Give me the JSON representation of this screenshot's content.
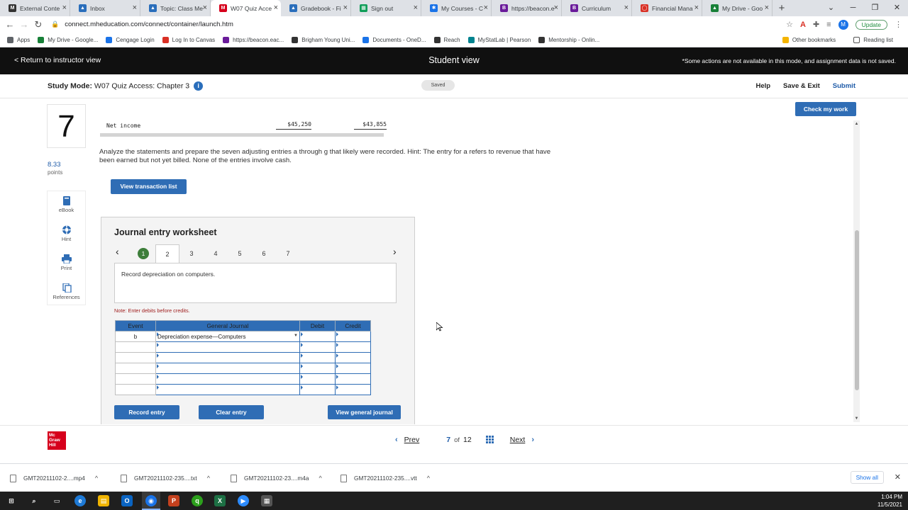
{
  "browser": {
    "tabs": [
      {
        "title": "External Conte",
        "fav_color": "#333333",
        "fav_glyph": "M"
      },
      {
        "title": "Inbox",
        "fav_color": "#2a6ebb",
        "fav_glyph": "▲"
      },
      {
        "title": "Topic: Class Me",
        "fav_color": "#2a6ebb",
        "fav_glyph": "▲"
      },
      {
        "title": "W07 Quiz Acce",
        "fav_color": "#d6001c",
        "fav_glyph": "M"
      },
      {
        "title": "Gradebook - Fi",
        "fav_color": "#2a6ebb",
        "fav_glyph": "▲"
      },
      {
        "title": "Sign out",
        "fav_color": "#0f9d58",
        "fav_glyph": "▦"
      },
      {
        "title": "My Courses - C",
        "fav_color": "#1a73e8",
        "fav_glyph": "✱"
      },
      {
        "title": "https://beacon.e",
        "fav_color": "#6a1b9a",
        "fav_glyph": "B"
      },
      {
        "title": "Curriculum",
        "fav_color": "#6a1b9a",
        "fav_glyph": "B"
      },
      {
        "title": "Financial Mana",
        "fav_color": "#d93025",
        "fav_glyph": "◯"
      },
      {
        "title": "My Drive - Goo",
        "fav_color": "#188038",
        "fav_glyph": "▲"
      }
    ],
    "active_tab_index": 3,
    "url": "connect.mheducation.com/connect/container/launch.htm",
    "profile_initial": "M",
    "update_label": "Update",
    "bookmarks": [
      {
        "label": "Apps",
        "color": "#5f6368"
      },
      {
        "label": "My Drive - Google...",
        "color": "#188038"
      },
      {
        "label": "Cengage Login",
        "color": "#1a73e8"
      },
      {
        "label": "Log In to Canvas",
        "color": "#d93025"
      },
      {
        "label": "https://beacon.eac...",
        "color": "#6a1b9a"
      },
      {
        "label": "Brigham Young Uni...",
        "color": "#333333"
      },
      {
        "label": "Documents - OneD...",
        "color": "#1a73e8"
      },
      {
        "label": "Reach",
        "color": "#333333"
      },
      {
        "label": "MyStatLab | Pearson",
        "color": "#00838f"
      },
      {
        "label": "Mentorship - Onlin...",
        "color": "#333333"
      }
    ],
    "other_bookmarks": "Other bookmarks",
    "reading_list": "Reading list"
  },
  "student_bar": {
    "back_label": "< Return to instructor view",
    "center_title": "Student view",
    "note": "*Some actions are not available in this mode, and assignment data is not saved."
  },
  "study_bar": {
    "mode_label": "Study Mode:",
    "assignment": "W07 Quiz Access: Chapter 3",
    "info_glyph": "i",
    "saved_label": "Saved",
    "help": "Help",
    "save_exit": "Save & Exit",
    "submit": "Submit"
  },
  "question": {
    "number": "7",
    "points_value": "8.33",
    "points_label": "points",
    "check_label": "Check my work",
    "tools": [
      {
        "label": "eBook",
        "icon": "book-icon"
      },
      {
        "label": "Hint",
        "icon": "lifebuoy-icon"
      },
      {
        "label": "Print",
        "icon": "printer-icon"
      },
      {
        "label": "References",
        "icon": "copy-icon"
      }
    ],
    "net_income_label": "Net income",
    "net_income_values": [
      "$45,250",
      "$43,855"
    ],
    "instructions": "Analyze the statements and prepare the seven adjusting entries a through g that likely were recorded. Hint: The entry for a refers to revenue that have been earned but not yet billed. None of the entries involve cash.",
    "view_transaction_label": "View transaction list"
  },
  "worksheet": {
    "title": "Journal entry worksheet",
    "steps": [
      "1",
      "2",
      "3",
      "4",
      "5",
      "6",
      "7"
    ],
    "completed_step": "1",
    "current_step": "2",
    "description": "Record depreciation on computers.",
    "note": "Note: Enter debits before credits.",
    "columns": [
      "Event",
      "General Journal",
      "Debit",
      "Credit"
    ],
    "rows": [
      {
        "event": "b",
        "account": "Depreciation expense—Computers",
        "debit": "",
        "credit": ""
      },
      {
        "event": "",
        "account": "",
        "debit": "",
        "credit": ""
      },
      {
        "event": "",
        "account": "",
        "debit": "",
        "credit": ""
      },
      {
        "event": "",
        "account": "",
        "debit": "",
        "credit": ""
      },
      {
        "event": "",
        "account": "",
        "debit": "",
        "credit": ""
      },
      {
        "event": "",
        "account": "",
        "debit": "",
        "credit": ""
      }
    ],
    "record_label": "Record entry",
    "clear_label": "Clear entry",
    "view_journal_label": "View general journal"
  },
  "footer": {
    "logo_text": [
      "Mc",
      "Graw",
      "Hill"
    ],
    "prev_label": "Prev",
    "current_page": "7",
    "of_label": "of",
    "total_pages": "12",
    "next_label": "Next"
  },
  "downloads": {
    "items": [
      "GMT20211102-2....mp4",
      "GMT20211102-235....txt",
      "GMT20211102-23....m4a",
      "GMT20211102-235....vtt"
    ],
    "show_all": "Show all"
  },
  "taskbar": {
    "time": "1:04 PM",
    "date": "11/5/2021"
  },
  "colors": {
    "accent_blue": "#2f6db5",
    "brand_red": "#d6001c",
    "done_green": "#3d7e3a"
  }
}
